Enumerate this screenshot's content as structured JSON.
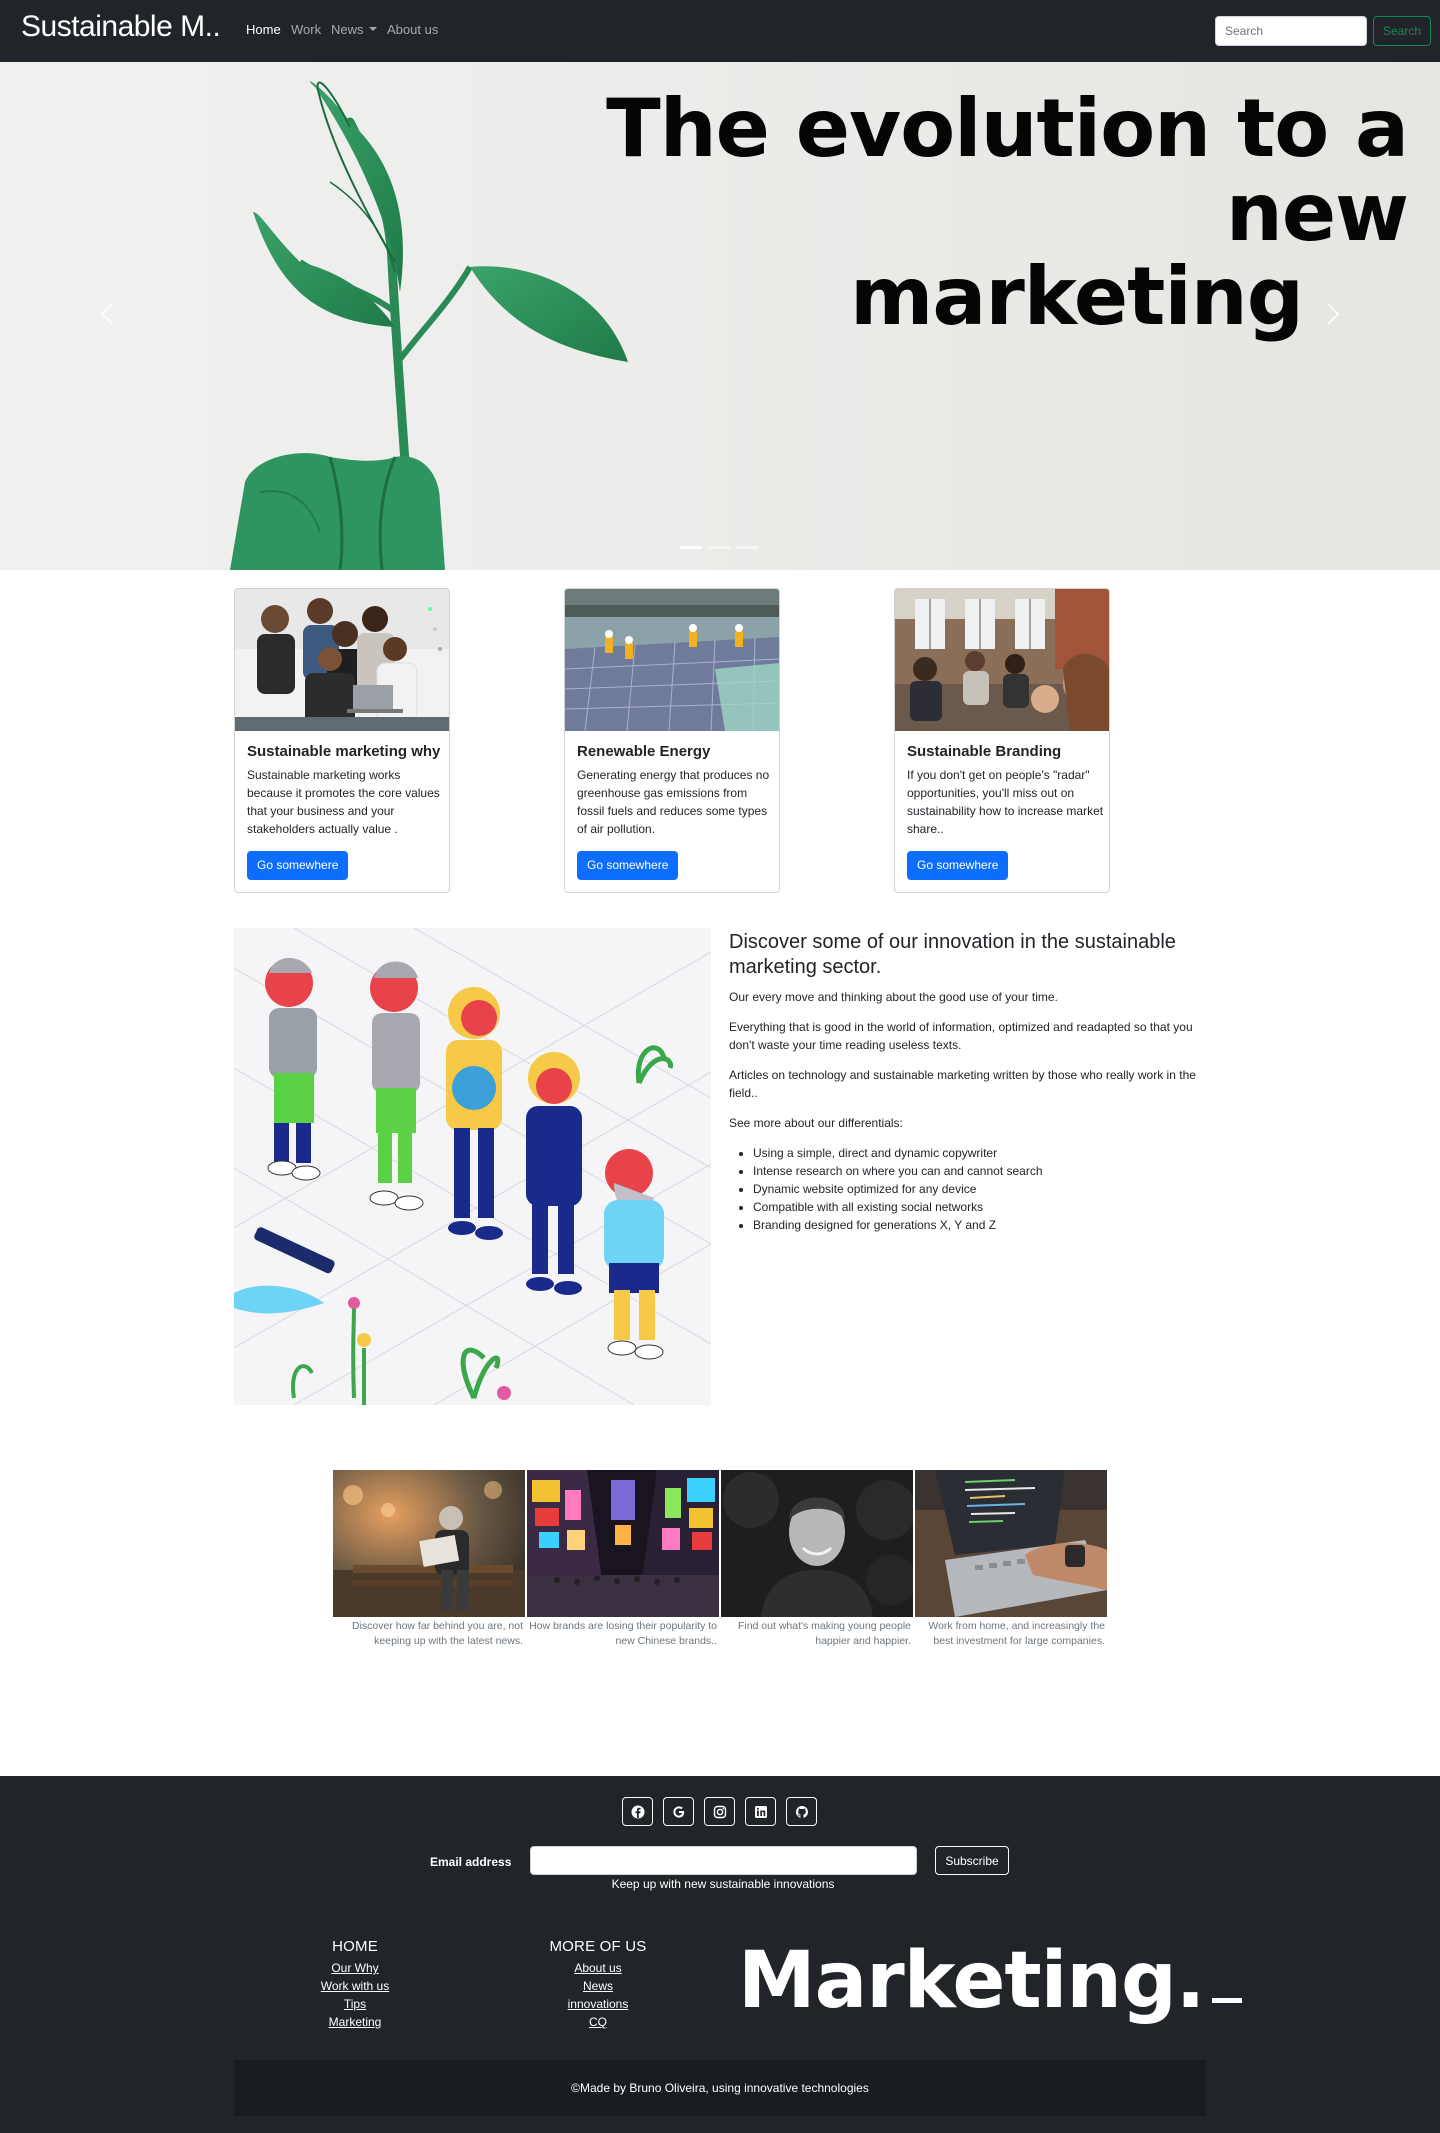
{
  "navbar": {
    "brand": "Sustainable M..",
    "links": [
      "Home",
      "Work",
      "News",
      "About us"
    ],
    "search_placeholder": "Search",
    "search_button": "Search"
  },
  "hero": {
    "title_line1": "The evolution to a new",
    "title_line2": "marketing",
    "slide_count": 3,
    "active_slide": 1
  },
  "cards": [
    {
      "title": "Sustainable marketing why",
      "text": "Sustainable marketing works because it promotes the core values that your business and your stakeholders actually value .",
      "button": "Go somewhere"
    },
    {
      "title": "Renewable Energy",
      "text": "Generating energy that produces no greenhouse gas emissions from fossil fuels and reduces some types of air pollution.",
      "button": "Go somewhere"
    },
    {
      "title": "Sustainable Branding",
      "text": "If you don't get on people's \"radar\" opportunities, you'll miss out on sustainability how to increase market share..",
      "button": "Go somewhere"
    }
  ],
  "innovation": {
    "title": "Discover some of our innovation in the sustainable marketing sector.",
    "paragraphs": [
      "Our every move and thinking about the good use of your time.",
      "Everything that is good in the world of information, optimized and readapted so that you don't waste your time reading useless texts.",
      "Articles on technology and sustainable marketing written by those who really work in the field..",
      "See more about our differentials:"
    ],
    "list": [
      "Using a simple, direct and dynamic copywriter",
      "Intense research on where you can and cannot search",
      "Dynamic website optimized for any device",
      "Compatible with all existing social networks",
      "Branding designed for generations X, Y and Z"
    ]
  },
  "gallery": [
    {
      "caption": "Discover how far behind you are, not keeping up with the latest news."
    },
    {
      "caption": "How brands are losing their popularity to new Chinese brands.."
    },
    {
      "caption": "Find out what's making young people happier and happier."
    },
    {
      "caption": "Work from home, and increasingly the best investment for large companies."
    }
  ],
  "footer": {
    "social_icons": [
      "facebook-icon",
      "google-icon",
      "instagram-icon",
      "linkedin-icon",
      "github-icon"
    ],
    "email_label": "Email address",
    "subscribe": "Subscribe",
    "keep_up": "Keep up with new sustainable innovations",
    "col1": {
      "title": "HOME",
      "links": [
        "Our Why",
        "Work with us",
        "Tips",
        "Marketing"
      ]
    },
    "col2": {
      "title": "MORE OF US",
      "links": [
        "About us",
        "News",
        "innovations",
        "CQ"
      ]
    },
    "big_text": "Marketing.",
    "copyright": "©Made by Bruno Oliveira, using innovative technologies"
  },
  "colors": {
    "navbar_bg": "#212529",
    "primary": "#0d6efd",
    "success": "#198754",
    "footer_bg": "#212529"
  }
}
